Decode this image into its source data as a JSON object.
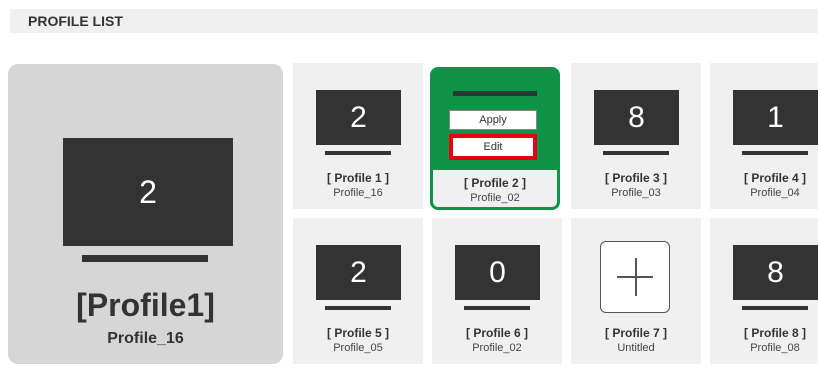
{
  "header": {
    "title": "PROFILE LIST"
  },
  "current": {
    "screen_number": "2",
    "name": "[Profile1]",
    "sub": "Profile_16"
  },
  "menu": {
    "apply_label": "Apply",
    "edit_label": "Edit"
  },
  "colors": {
    "selected": "#0f9447",
    "edit_outline": "#e3000f",
    "screen": "#333333"
  },
  "profiles": [
    {
      "label": "[ Profile 1 ]",
      "sub": "Profile_16",
      "screen_number": "2"
    },
    {
      "label": "[ Profile 2 ]",
      "sub": "Profile_02",
      "screen_number": ""
    },
    {
      "label": "[ Profile 3 ]",
      "sub": "Profile_03",
      "screen_number": "8"
    },
    {
      "label": "[ Profile 4 ]",
      "sub": "Profile_04",
      "screen_number": "1"
    },
    {
      "label": "[ Profile 5 ]",
      "sub": "Profile_05",
      "screen_number": "2"
    },
    {
      "label": "[ Profile 6 ]",
      "sub": "Profile_02",
      "screen_number": "0"
    },
    {
      "label": "[ Profile 7 ]",
      "sub": "Untitled",
      "icon": "plus-icon"
    },
    {
      "label": "[ Profile 8 ]",
      "sub": "Profile_08",
      "screen_number": "8"
    }
  ]
}
